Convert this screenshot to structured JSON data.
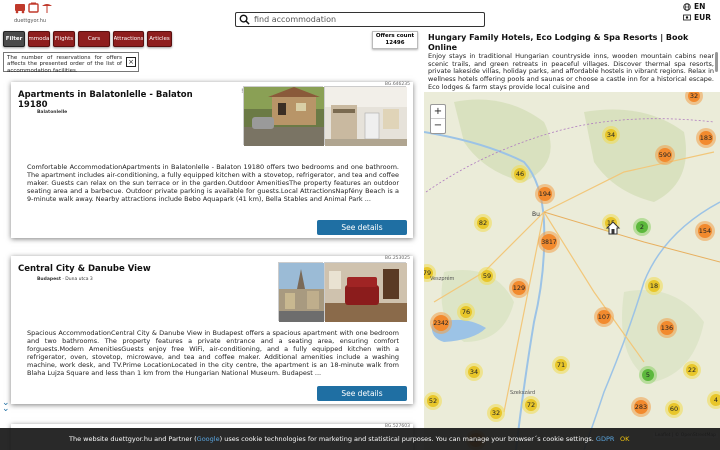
{
  "header": {
    "logo_text": "duettgyor.hu",
    "search_placeholder": "find accommodation",
    "lang_current": "EN",
    "currency": "EUR"
  },
  "filters": {
    "items": [
      "Filter",
      "Accommodations",
      "Flights",
      "Cars",
      "Attractions",
      "Articles"
    ],
    "offers_label": "Offers count",
    "offers_count": "12496",
    "notice": "The number of reservations for offers affects the presented order of the list of accommodation facilities.",
    "notice_close": "×"
  },
  "listings": [
    {
      "id": "BG.646235",
      "title_line1": "Apartments in Balatonlelle - Balaton",
      "title_line2": "19180",
      "location": "Balatonlelle",
      "address": "",
      "description": "Comfortable AccommodationApartments in Balatonlelle - Balaton 19180 offers two bedrooms and one bathroom. The apartment includes air-conditioning, a fully equipped kitchen with a stovetop, refrigerator, and tea and coffee maker. Guests can relax on the sun terrace or in the garden.Outdoor AmenitiesThe property features an outdoor seating area and a barbecue. Outdoor private parking is available for guests.Local AttractionsNapfény Beach is a 9-minute walk away. Nearby attractions include Bebo Aquapark (41 km), Bella Stables and Animal Park ...",
      "button": "See details",
      "mark": "!"
    },
    {
      "id": "BG.253025",
      "title_line1": "Central City & Danube View",
      "title_line2": "",
      "location": "Budapest",
      "address": " · Duna utca 3",
      "description": "Spacious AccommodationCentral City & Danube View in Budapest offers a spacious apartment with one bedroom and two bathrooms. The property features a private entrance and a seating area, ensuring comfort forguests.Modern AmenitiesGuests enjoy free WiFi, air-conditioning, and a fully equipped kitchen with a refrigerator, oven, stovetop, microwave, and tea and coffee maker. Additional amenities include a washing machine, work desk, and TV.Prime LocationLocated in the city centre, the apartment is an 18-minute walk from Blaha Lujza Square and less than 1 km from the Hungarian National Museum. Budapest ...",
      "button": "See details",
      "mark": ""
    },
    {
      "id": "BG.527603",
      "title_line1": "",
      "title_line2": "",
      "location": "",
      "address": "",
      "description": "",
      "button": "",
      "mark": ""
    }
  ],
  "right": {
    "title": "Hungary Family Hotels, Eco Lodging & Spa Resorts | Book Online",
    "description": "Enjoy stays in traditional Hungarian countryside inns, wooden mountain cabins near scenic trails, and green retreats in peaceful villages. Discover thermal spa resorts, private lakeside villas, holiday parks, and affordable hostels in vibrant regions. Relax in wellness hotels offering pools and saunas or choose a castle inn for a historical escape. Eco lodges & farm stays provide local cuisine and"
  },
  "map": {
    "zoom_in": "+",
    "zoom_out": "−",
    "attribution": "Leaflet | © OpenStreetMap",
    "city_label": "Bu",
    "city_label2": "Veszprém",
    "city_label3": "Szekszárd",
    "colors": {
      "orange": "#f0a04a",
      "orange_inner": "#f28a2e",
      "yellow": "#f0dc52",
      "yellow_inner": "#e8c62a",
      "green": "#8ed16a",
      "green_inner": "#5cb83c",
      "red": "#f07a52"
    },
    "clusters": [
      {
        "label": "32",
        "color": "orange"
      },
      {
        "label": "34",
        "color": "yellow"
      },
      {
        "label": "183",
        "color": "orange"
      },
      {
        "label": "590",
        "color": "orange"
      },
      {
        "label": "46",
        "color": "yellow"
      },
      {
        "label": "194",
        "color": "orange"
      },
      {
        "label": "82",
        "color": "yellow"
      },
      {
        "label": "15",
        "color": "yellow"
      },
      {
        "label": "2",
        "color": "green"
      },
      {
        "label": "154",
        "color": "orange"
      },
      {
        "label": "3817",
        "color": "orange"
      },
      {
        "label": "79",
        "color": "yellow"
      },
      {
        "label": "59",
        "color": "yellow"
      },
      {
        "label": "129",
        "color": "orange"
      },
      {
        "label": "18",
        "color": "yellow"
      },
      {
        "label": "76",
        "color": "yellow"
      },
      {
        "label": "107",
        "color": "orange"
      },
      {
        "label": "2342",
        "color": "orange"
      },
      {
        "label": "136",
        "color": "orange"
      },
      {
        "label": "34",
        "color": "yellow"
      },
      {
        "label": "71",
        "color": "yellow"
      },
      {
        "label": "5",
        "color": "green"
      },
      {
        "label": "22",
        "color": "yellow"
      },
      {
        "label": "52",
        "color": "yellow"
      },
      {
        "label": "72",
        "color": "yellow"
      },
      {
        "label": "32",
        "color": "yellow"
      },
      {
        "label": "283",
        "color": "orange"
      },
      {
        "label": "60",
        "color": "yellow"
      },
      {
        "label": "4",
        "color": "yellow"
      },
      {
        "label": "394",
        "color": "orange"
      }
    ]
  },
  "cookie": {
    "text_before": "The website duettgyor.hu and Partner (",
    "link1": "Google",
    "text_after": ") uses cookie technologies for marketing and statistical purposes. You can manage your browser´s cookie settings. ",
    "link2": "GDPR",
    "ok": "OK"
  }
}
